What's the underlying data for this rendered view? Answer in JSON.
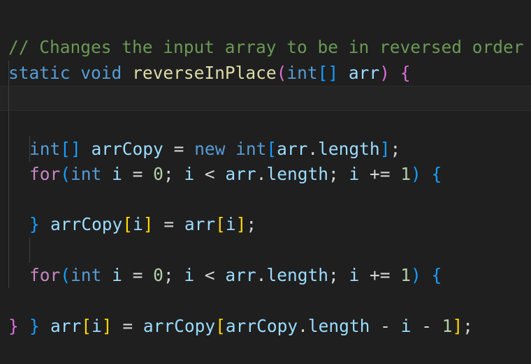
{
  "editor": {
    "comment": "// Changes the input array to be in reversed order",
    "signature": {
      "kw_static": "static",
      "kw_void": "void",
      "method_name": "reverseInPlace",
      "open_paren": "(",
      "param_type": "int",
      "param_brackets": "[]",
      "param_name": "arr",
      "close_paren": ")",
      "open_brace": "{"
    },
    "decl": {
      "type": "int",
      "brackets": "[]",
      "name": "arrCopy",
      "assign": " = ",
      "new": "new",
      "new_type": "int",
      "open_bracket": "[",
      "obj": "arr",
      "dot": ".",
      "prop": "length",
      "close_bracket": "]",
      "semi": ";"
    },
    "loop1": {
      "kw_for": "for",
      "open_paren": "(",
      "int": "int",
      "i": "i",
      "init": " = ",
      "zero": "0",
      "semi1": "; ",
      "i2": "i",
      "lt": " < ",
      "arr": "arr",
      "dot": ".",
      "length": "length",
      "semi2": "; ",
      "i3": "i",
      "plus_eq": " += ",
      "one": "1",
      "close_paren": ")",
      "open_brace": "{"
    },
    "body1": {
      "lhs": "arrCopy",
      "ob": "[",
      "i": "i",
      "cb": "]",
      "assign": " = ",
      "rhs": "arr",
      "ob2": "[",
      "i2": "i",
      "cb2": "]",
      "semi": ";"
    },
    "loop2": {
      "kw_for": "for",
      "open_paren": "(",
      "int": "int",
      "i": "i",
      "init": " = ",
      "zero": "0",
      "semi1": "; ",
      "i2": "i",
      "lt": " < ",
      "arr": "arr",
      "dot": ".",
      "length": "length",
      "semi2": "; ",
      "i3": "i",
      "plus_eq": " += ",
      "one": "1",
      "close_paren": ")",
      "open_brace": "{"
    },
    "body2": {
      "lhs": "arr",
      "ob": "[",
      "i": "i",
      "cb": "]",
      "assign": " = ",
      "rhs": "arrCopy",
      "ob2": "[",
      "inner_obj": "arrCopy",
      "dot": ".",
      "prop": "length",
      "minus1": " - ",
      "i2": "i",
      "minus2": " - ",
      "one": "1",
      "cb2": "]",
      "semi": ";"
    },
    "close_brace": "}"
  },
  "colors": {
    "background": "#1f1f1f",
    "comment": "#6a9955",
    "keyword": "#569cd6",
    "control": "#c586c0",
    "function": "#dcdcaa",
    "variable": "#9cdcfe",
    "number": "#b5cea8",
    "bracket_level1": "#ffd700",
    "bracket_level2": "#da70d6",
    "bracket_level3": "#179fff"
  }
}
